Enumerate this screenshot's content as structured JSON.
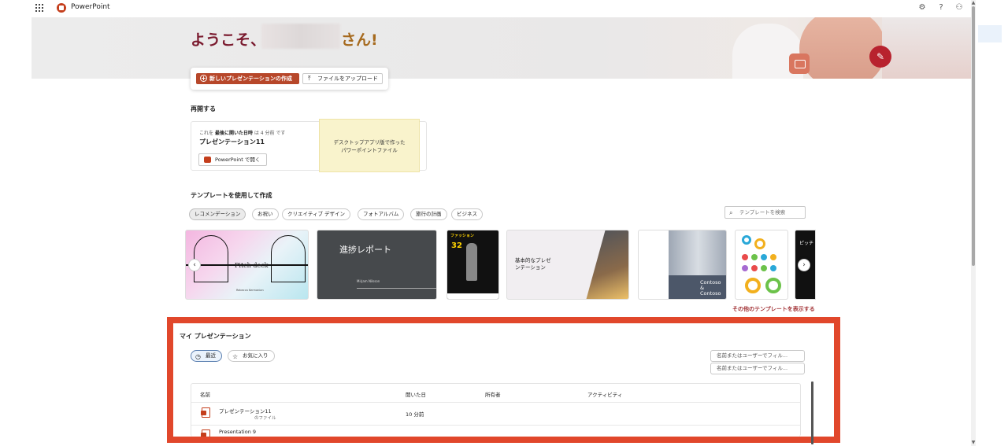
{
  "app": {
    "name": "PowerPoint"
  },
  "hero": {
    "welcome_prefix": "ようこそ、",
    "welcome_suffix": "さん!"
  },
  "actions": {
    "new_label": "新しいプレゼンテーションの作成",
    "upload_label": "ファイルをアップロード"
  },
  "resume": {
    "section_title": "再開する",
    "meta_prefix": "これを",
    "meta_bold": "最後に開いた日時",
    "meta_suffix": "は 4 分前 です",
    "file_title": "プレゼンテーション11",
    "open_button": "PowerPoint で開く",
    "sticky_note": "デスクトップアプリ版で作った\nパワーポイントファイル"
  },
  "templates": {
    "section_title": "テンプレートを使用して作成",
    "categories": [
      "レコメンデーション",
      "お祝い",
      "クリエイティブ デザイン",
      "フォトアルバム",
      "旅行の計画",
      "ビジネス"
    ],
    "active_category": 0,
    "search_placeholder": "テンプレートを検索",
    "cards": [
      {
        "title": "Pitch deck",
        "subtitle": "Rebecca Kermanian"
      },
      {
        "title": "進捗レポート",
        "subtitle": "Mirjam Nilsson"
      },
      {
        "title": "ファッション",
        "number": "32"
      },
      {
        "title": "基本的なプレゼ\nンテーション"
      },
      {
        "title": "Contoso &\nContoso"
      },
      {
        "title": ""
      },
      {
        "title": "ピッチ デ"
      }
    ],
    "more_link": "その他のテンプレートを表示する"
  },
  "my_presentations": {
    "title": "マイ プレゼンテーション",
    "filters": [
      "最近",
      "お気に入り"
    ],
    "name_filter_placeholder": "名前またはユーザーでフィル...",
    "columns": [
      "名前",
      "開いた日",
      "所有者",
      "アクティビティ"
    ],
    "rows": [
      {
        "name": "プレゼンテーション11",
        "location": "のファイル",
        "opened": "10 分前",
        "owner": "",
        "activity": ""
      },
      {
        "name": "Presentation 9",
        "location": "",
        "opened": "",
        "owner": "",
        "activity": ""
      }
    ]
  },
  "colors": {
    "brand": "#b7472a",
    "highlight_frame": "#e1472b",
    "welcome": "#7a1a2e"
  }
}
